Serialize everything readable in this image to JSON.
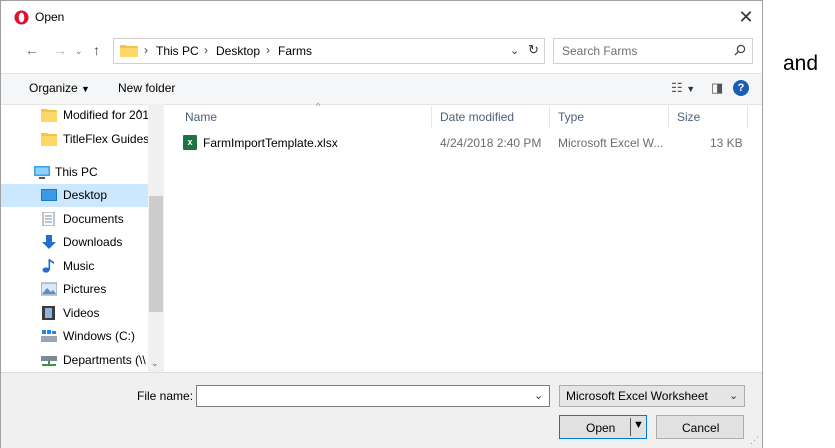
{
  "window": {
    "title": "Open"
  },
  "outside_text": "and",
  "address": {
    "crumbs": [
      "This PC",
      "Desktop",
      "Farms"
    ],
    "search_placeholder": "Search Farms"
  },
  "toolbar": {
    "organize": "Organize",
    "new_folder": "New folder"
  },
  "sidebar": {
    "items": [
      {
        "label": "Modified for 201",
        "icon": "folder-icon"
      },
      {
        "label": "TitleFlex Guides",
        "icon": "folder-icon"
      },
      {
        "label": "This PC",
        "icon": "computer-icon"
      },
      {
        "label": "Desktop",
        "icon": "desktop-icon"
      },
      {
        "label": "Documents",
        "icon": "documents-icon"
      },
      {
        "label": "Downloads",
        "icon": "downloads-icon"
      },
      {
        "label": "Music",
        "icon": "music-icon"
      },
      {
        "label": "Pictures",
        "icon": "pictures-icon"
      },
      {
        "label": "Videos",
        "icon": "videos-icon"
      },
      {
        "label": "Windows (C:)",
        "icon": "drive-icon"
      },
      {
        "label": "Departments (\\\\",
        "icon": "network-drive-icon"
      }
    ]
  },
  "columns": {
    "name": "Name",
    "date": "Date modified",
    "type": "Type",
    "size": "Size"
  },
  "files": [
    {
      "name": "FarmImportTemplate.xlsx",
      "date": "4/24/2018 2:40 PM",
      "type": "Microsoft Excel W...",
      "size": "13 KB"
    }
  ],
  "bottom": {
    "file_name_label": "File name:",
    "file_name_value": "",
    "file_type": "Microsoft Excel Worksheet",
    "open_label": "Open",
    "cancel_label": "Cancel"
  }
}
